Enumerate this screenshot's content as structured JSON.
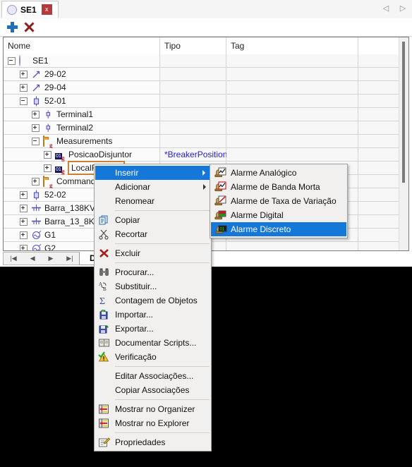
{
  "window": {
    "tab": {
      "label": "SE1",
      "close_label": "x",
      "icon": "substation-circle-icon"
    },
    "nav": {
      "prev": "◁",
      "next": "▷"
    }
  },
  "toolbar": {
    "add_label": "+",
    "delete_label": "X"
  },
  "grid": {
    "columns": [
      "Nome",
      "Tipo",
      "Tag",
      ""
    ],
    "rows": [
      {
        "indent": 0,
        "expander": "minus",
        "icon": "substation-circle-icon",
        "name": "SE1",
        "tipo": "",
        "tag": ""
      },
      {
        "indent": 1,
        "expander": "plus",
        "icon": "disconnector-icon",
        "name": "29-02",
        "tipo": "",
        "tag": ""
      },
      {
        "indent": 1,
        "expander": "plus",
        "icon": "disconnector-icon",
        "name": "29-04",
        "tipo": "",
        "tag": ""
      },
      {
        "indent": 1,
        "expander": "minus",
        "icon": "breaker-icon",
        "name": "52-01",
        "tipo": "",
        "tag": ""
      },
      {
        "indent": 2,
        "expander": "plus",
        "icon": "terminal-icon",
        "name": "Terminal1",
        "tipo": "",
        "tag": ""
      },
      {
        "indent": 2,
        "expander": "plus",
        "icon": "terminal-icon",
        "name": "Terminal2",
        "tipo": "",
        "tag": ""
      },
      {
        "indent": 2,
        "expander": "minus",
        "icon": "folder-icon",
        "name": "Measurements",
        "tipo": "",
        "tag": ""
      },
      {
        "indent": 3,
        "expander": "plus",
        "icon": "measurement-icon",
        "name": "PosicaoDisjuntor",
        "tipo": "*BreakerPosition",
        "tag": ""
      },
      {
        "indent": 3,
        "expander": "plus",
        "icon": "measurement-icon",
        "name": "LocalRemoto",
        "tipo": "",
        "tag": "",
        "selected": true
      },
      {
        "indent": 2,
        "expander": "plus",
        "icon": "folder-icon",
        "name": "Commands",
        "tipo": "",
        "tag": ""
      },
      {
        "indent": 1,
        "expander": "plus",
        "icon": "breaker-icon",
        "name": "52-02",
        "tipo": "",
        "tag": ""
      },
      {
        "indent": 1,
        "expander": "plus",
        "icon": "busbar-icon",
        "name": "Barra_138KV",
        "tipo": "",
        "tag": ""
      },
      {
        "indent": 1,
        "expander": "plus",
        "icon": "busbar-icon",
        "name": "Barra_13_8KV",
        "tipo": "",
        "tag": ""
      },
      {
        "indent": 1,
        "expander": "plus",
        "icon": "generator-icon",
        "name": "G1",
        "tipo": "",
        "tag": ""
      },
      {
        "indent": 1,
        "expander": "plus",
        "icon": "generator-icon",
        "name": "G2",
        "tipo": "",
        "tag": ""
      }
    ]
  },
  "bottom": {
    "nav": [
      "|◀",
      "◀",
      "▶",
      "▶|"
    ],
    "design_tab": "Design"
  },
  "context_menu": {
    "items": [
      {
        "label": "Inserir",
        "icon": "none",
        "submenu": true,
        "selected": true
      },
      {
        "label": "Adicionar",
        "icon": "none",
        "submenu": true
      },
      {
        "label": "Renomear",
        "icon": "none"
      },
      {
        "separator": true
      },
      {
        "label": "Copiar",
        "icon": "copy-icon"
      },
      {
        "label": "Recortar",
        "icon": "scissors-icon"
      },
      {
        "separator": true
      },
      {
        "label": "Excluir",
        "icon": "delete-x-icon"
      },
      {
        "separator": true
      },
      {
        "label": "Procurar...",
        "icon": "binoculars-icon"
      },
      {
        "label": "Substituir...",
        "icon": "replace-icon"
      },
      {
        "label": "Contagem de Objetos",
        "icon": "sigma-icon"
      },
      {
        "label": "Importar...",
        "icon": "import-disk-icon"
      },
      {
        "label": "Exportar...",
        "icon": "export-disk-icon"
      },
      {
        "label": "Documentar Scripts...",
        "icon": "book-icon"
      },
      {
        "label": "Verificação",
        "icon": "warning-check-icon"
      },
      {
        "separator": true
      },
      {
        "label": "Editar Associações...",
        "icon": "none"
      },
      {
        "label": "Copiar Associações",
        "icon": "none"
      },
      {
        "separator": true
      },
      {
        "label": "Mostrar no Organizer",
        "icon": "organizer-icon"
      },
      {
        "label": "Mostrar no Explorer",
        "icon": "explorer-icon"
      },
      {
        "separator": true
      },
      {
        "label": "Propriedades",
        "icon": "properties-icon"
      }
    ]
  },
  "submenu": {
    "items": [
      {
        "label": "Alarme Analógico",
        "icon": "alarm-analog-icon"
      },
      {
        "label": "Alarme de Banda Morta",
        "icon": "alarm-deadband-icon"
      },
      {
        "label": "Alarme de Taxa de Variação",
        "icon": "alarm-rate-icon"
      },
      {
        "label": "Alarme Digital",
        "icon": "alarm-digital-icon"
      },
      {
        "label": "Alarme Discreto",
        "icon": "alarm-discrete-icon",
        "selected": true
      }
    ]
  },
  "colors": {
    "highlight": "#1577d8",
    "tab_close": "#b33b3b",
    "tipo_text": "#2222cc",
    "selection_border": "#d4893c",
    "add_icon": "#1e70b8",
    "delete_icon": "#8c1f1f"
  }
}
